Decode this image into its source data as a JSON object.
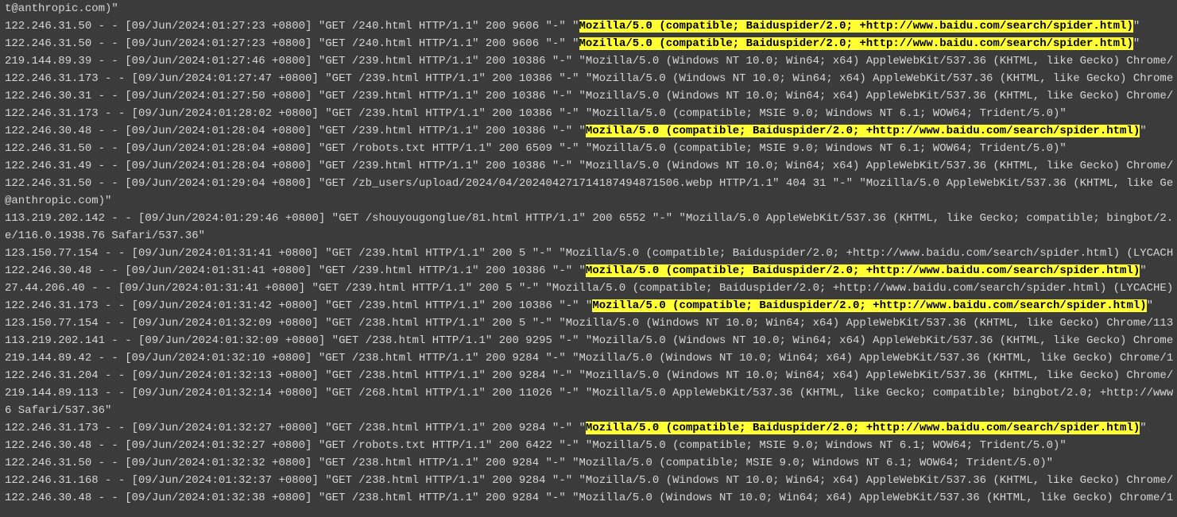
{
  "highlight_phrase": "Mozilla/5.0 (compatible; Baiduspider/2.0; +http://www.baidu.com/search/spider.html)",
  "log_lines": [
    {
      "text": "t@anthropic.com)\""
    },
    {
      "prefix": "122.246.31.50 - - [09/Jun/2024:01:27:23 +0800] \"GET /240.html HTTP/1.1\" 200 9606 \"-\" \"",
      "hl": "Mozilla/5.0 (compatible; Baiduspider/2.0; +http://www.baidu.com/search/spider.html)",
      "suffix": "\""
    },
    {
      "prefix": "122.246.31.50 - - [09/Jun/2024:01:27:23 +0800] \"GET /240.html HTTP/1.1\" 200 9606 \"-\" \"",
      "hl": "Mozilla/5.0 (compatible; Baiduspider/2.0; +http://www.baidu.com/search/spider.html)",
      "suffix": "\""
    },
    {
      "text": "219.144.89.39 - - [09/Jun/2024:01:27:46 +0800] \"GET /239.html HTTP/1.1\" 200 10386 \"-\" \"Mozilla/5.0 (Windows NT 10.0; Win64; x64) AppleWebKit/537.36 (KHTML, like Gecko) Chrome/"
    },
    {
      "text": "122.246.31.173 - - [09/Jun/2024:01:27:47 +0800] \"GET /239.html HTTP/1.1\" 200 10386 \"-\" \"Mozilla/5.0 (Windows NT 10.0; Win64; x64) AppleWebKit/537.36 (KHTML, like Gecko) Chrome"
    },
    {
      "text": "122.246.30.31 - - [09/Jun/2024:01:27:50 +0800] \"GET /239.html HTTP/1.1\" 200 10386 \"-\" \"Mozilla/5.0 (Windows NT 10.0; Win64; x64) AppleWebKit/537.36 (KHTML, like Gecko) Chrome/"
    },
    {
      "text": "122.246.31.173 - - [09/Jun/2024:01:28:02 +0800] \"GET /239.html HTTP/1.1\" 200 10386 \"-\" \"Mozilla/5.0 (compatible; MSIE 9.0; Windows NT 6.1; WOW64; Trident/5.0)\""
    },
    {
      "prefix": "122.246.30.48 - - [09/Jun/2024:01:28:04 +0800] \"GET /239.html HTTP/1.1\" 200 10386 \"-\" \"",
      "hl": "Mozilla/5.0 (compatible; Baiduspider/2.0; +http://www.baidu.com/search/spider.html)",
      "suffix": "\""
    },
    {
      "text": "122.246.31.50 - - [09/Jun/2024:01:28:04 +0800] \"GET /robots.txt HTTP/1.1\" 200 6509 \"-\" \"Mozilla/5.0 (compatible; MSIE 9.0; Windows NT 6.1; WOW64; Trident/5.0)\""
    },
    {
      "text": "122.246.31.49 - - [09/Jun/2024:01:28:04 +0800] \"GET /239.html HTTP/1.1\" 200 10386 \"-\" \"Mozilla/5.0 (Windows NT 10.0; Win64; x64) AppleWebKit/537.36 (KHTML, like Gecko) Chrome/"
    },
    {
      "text": "122.246.31.50 - - [09/Jun/2024:01:29:04 +0800] \"GET /zb_users/upload/2024/04/202404271714187494871506.webp HTTP/1.1\" 404 31 \"-\" \"Mozilla/5.0 AppleWebKit/537.36 (KHTML, like Ge"
    },
    {
      "text": "@anthropic.com)\""
    },
    {
      "text": "113.219.202.142 - - [09/Jun/2024:01:29:46 +0800] \"GET /shouyougonglue/81.html HTTP/1.1\" 200 6552 \"-\" \"Mozilla/5.0 AppleWebKit/537.36 (KHTML, like Gecko; compatible; bingbot/2."
    },
    {
      "text": "e/116.0.1938.76 Safari/537.36\""
    },
    {
      "text": "123.150.77.154 - - [09/Jun/2024:01:31:41 +0800] \"GET /239.html HTTP/1.1\" 200 5 \"-\" \"Mozilla/5.0 (compatible; Baiduspider/2.0; +http://www.baidu.com/search/spider.html) (LYCACH"
    },
    {
      "prefix": "122.246.30.48 - - [09/Jun/2024:01:31:41 +0800] \"GET /239.html HTTP/1.1\" 200 10386 \"-\" \"",
      "hl": "Mozilla/5.0 (compatible; Baiduspider/2.0; +http://www.baidu.com/search/spider.html)",
      "suffix": "\""
    },
    {
      "text": "27.44.206.40 - - [09/Jun/2024:01:31:41 +0800] \"GET /239.html HTTP/1.1\" 200 5 \"-\" \"Mozilla/5.0 (compatible; Baiduspider/2.0; +http://www.baidu.com/search/spider.html) (LYCACHE)"
    },
    {
      "prefix": "122.246.31.173 - - [09/Jun/2024:01:31:42 +0800] \"GET /239.html HTTP/1.1\" 200 10386 \"-\" \"",
      "hl": "Mozilla/5.0 (compatible; Baiduspider/2.0; +http://www.baidu.com/search/spider.html)",
      "suffix": "\""
    },
    {
      "text": "123.150.77.154 - - [09/Jun/2024:01:32:09 +0800] \"GET /238.html HTTP/1.1\" 200 5 \"-\" \"Mozilla/5.0 (Windows NT 10.0; Win64; x64) AppleWebKit/537.36 (KHTML, like Gecko) Chrome/113"
    },
    {
      "text": "113.219.202.141 - - [09/Jun/2024:01:32:09 +0800] \"GET /238.html HTTP/1.1\" 200 9295 \"-\" \"Mozilla/5.0 (Windows NT 10.0; Win64; x64) AppleWebKit/537.36 (KHTML, like Gecko) Chrome"
    },
    {
      "text": "219.144.89.42 - - [09/Jun/2024:01:32:10 +0800] \"GET /238.html HTTP/1.1\" 200 9284 \"-\" \"Mozilla/5.0 (Windows NT 10.0; Win64; x64) AppleWebKit/537.36 (KHTML, like Gecko) Chrome/1"
    },
    {
      "text": "122.246.31.204 - - [09/Jun/2024:01:32:13 +0800] \"GET /238.html HTTP/1.1\" 200 9284 \"-\" \"Mozilla/5.0 (Windows NT 10.0; Win64; x64) AppleWebKit/537.36 (KHTML, like Gecko) Chrome/"
    },
    {
      "text": "219.144.89.113 - - [09/Jun/2024:01:32:14 +0800] \"GET /268.html HTTP/1.1\" 200 11026 \"-\" \"Mozilla/5.0 AppleWebKit/537.36 (KHTML, like Gecko; compatible; bingbot/2.0; +http://www"
    },
    {
      "text": "6 Safari/537.36\""
    },
    {
      "prefix": "122.246.31.173 - - [09/Jun/2024:01:32:27 +0800] \"GET /238.html HTTP/1.1\" 200 9284 \"-\" \"",
      "hl": "Mozilla/5.0 (compatible; Baiduspider/2.0; +http://www.baidu.com/search/spider.html)",
      "suffix": "\""
    },
    {
      "text": "122.246.30.48 - - [09/Jun/2024:01:32:27 +0800] \"GET /robots.txt HTTP/1.1\" 200 6422 \"-\" \"Mozilla/5.0 (compatible; MSIE 9.0; Windows NT 6.1; WOW64; Trident/5.0)\""
    },
    {
      "text": "122.246.31.50 - - [09/Jun/2024:01:32:32 +0800] \"GET /238.html HTTP/1.1\" 200 9284 \"-\" \"Mozilla/5.0 (compatible; MSIE 9.0; Windows NT 6.1; WOW64; Trident/5.0)\""
    },
    {
      "text": "122.246.31.168 - - [09/Jun/2024:01:32:37 +0800] \"GET /238.html HTTP/1.1\" 200 9284 \"-\" \"Mozilla/5.0 (Windows NT 10.0; Win64; x64) AppleWebKit/537.36 (KHTML, like Gecko) Chrome/"
    },
    {
      "text": "122.246.30.48 - - [09/Jun/2024:01:32:38 +0800] \"GET /238.html HTTP/1.1\" 200 9284 \"-\" \"Mozilla/5.0 (Windows NT 10.0; Win64; x64) AppleWebKit/537.36 (KHTML, like Gecko) Chrome/1"
    }
  ]
}
